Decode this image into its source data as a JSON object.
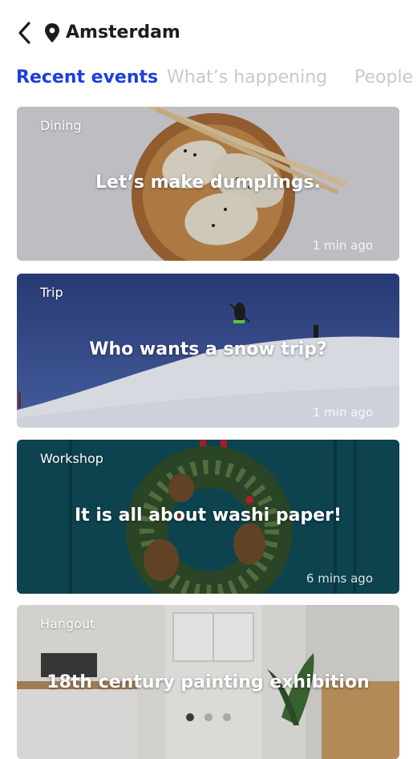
{
  "header": {
    "back_icon": "chevron-left-icon",
    "location_icon": "map-pin-icon",
    "city": "Amsterdam"
  },
  "tabs": [
    {
      "label": "Recent events",
      "active": true
    },
    {
      "label": "What’s happening",
      "active": false
    },
    {
      "label": "People",
      "active": false
    }
  ],
  "cards": [
    {
      "category": "Dining",
      "title": "Let’s make dumplings.",
      "time": "1 min ago"
    },
    {
      "category": "Trip",
      "title": "Who wants a snow trip?",
      "time": "1 min ago"
    },
    {
      "category": "Workshop",
      "title": "It is all about washi paper!",
      "time": "6 mins ago"
    },
    {
      "category": "Hangout",
      "title": "18th century painting exhibition",
      "time": ""
    }
  ],
  "pagination": {
    "count": 3,
    "active_index": 0
  },
  "colors": {
    "accent": "#1d3fe0",
    "inactive_tab": "#c9c9c9",
    "text_dark": "#1c1c1c"
  }
}
